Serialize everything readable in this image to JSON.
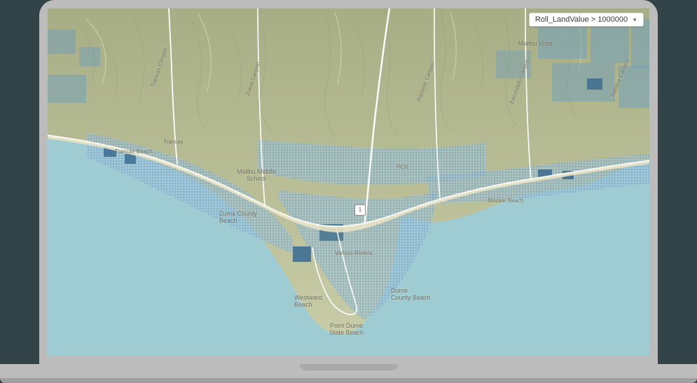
{
  "filter": {
    "expression": "Roll_LandValue > 1000000"
  },
  "road_badge": "1",
  "labels": {
    "malibu_vista": "Malibu Vista",
    "malibu_middle_school": "Malibu Middle\nSchool",
    "zuma_county_beach": "Zuma County\nBeach",
    "westward_beach": "Westward\nBeach",
    "point_dume_state_beach": "Point Dume\nState Beach",
    "dume_county_beach": "Dume\nCounty Beach",
    "zuma_canyon": "Zuma Canyon",
    "ramirez_canyon": "Ramirez Canyon",
    "trancas_canyon": "Trancas Canyon",
    "escondido_canyon": "Escondido Canyon",
    "solstice_canyon": "Solstice Canyon",
    "trancas": "Trancas",
    "dan_blocker_beach": "Blocker Beach",
    "trancas_beach": "Trancas Beach",
    "pch": "PCH",
    "vancus_riviera": "Vancus Riviera"
  },
  "colors": {
    "ocean": "#9fccd3",
    "terrain_base": "#b8bd99",
    "terrain_light": "#ced2af",
    "parcel_fill": "#6b9ec2",
    "parcel_dark": "#4d7ea3",
    "road": "#ffffff"
  }
}
